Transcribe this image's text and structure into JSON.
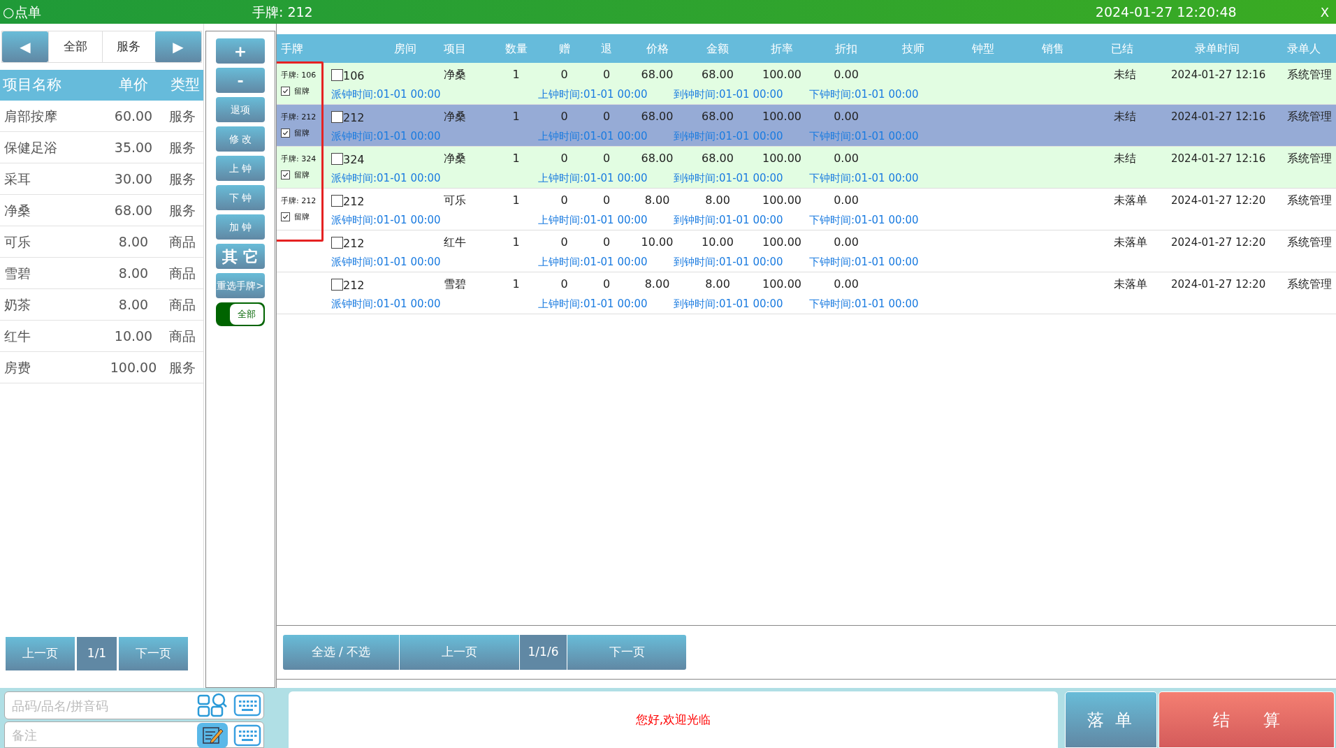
{
  "title_bar": {
    "title": "○点单",
    "tag": "手牌: 212",
    "datetime": "2024-01-27 12:20:48",
    "close": "X"
  },
  "category_nav": {
    "prev": "◀",
    "tabs": [
      {
        "label": "全部"
      },
      {
        "label": "服务"
      }
    ],
    "next": "▶"
  },
  "item_list": {
    "columns": [
      "项目名称",
      "单价",
      "类型"
    ],
    "rows": [
      [
        "肩部按摩",
        "60.00",
        "服务"
      ],
      [
        "保健足浴",
        "35.00",
        "服务"
      ],
      [
        "采耳",
        "30.00",
        "服务"
      ],
      [
        "净桑",
        "68.00",
        "服务"
      ],
      [
        "可乐",
        "8.00",
        "商品"
      ],
      [
        "雪碧",
        "8.00",
        "商品"
      ],
      [
        "奶茶",
        "8.00",
        "商品"
      ],
      [
        "红牛",
        "10.00",
        "商品"
      ],
      [
        "房费",
        "100.00",
        "服务"
      ]
    ],
    "pager": {
      "prev": "上一页",
      "page": "1/1",
      "next": "下一页"
    }
  },
  "actions": [
    {
      "label": "+",
      "kind": "large"
    },
    {
      "label": "-",
      "kind": "large"
    },
    {
      "label": "退项",
      "kind": "normal"
    },
    {
      "label": "修 改",
      "kind": "normal"
    },
    {
      "label": "上 钟",
      "kind": "normal"
    },
    {
      "label": "下 钟",
      "kind": "normal"
    },
    {
      "label": "加 钟",
      "kind": "normal"
    },
    {
      "label": "其 它",
      "kind": "large"
    },
    {
      "label": "重选手牌>",
      "kind": "normal"
    }
  ],
  "filter_toggle": {
    "label": "全部",
    "on": true
  },
  "orders": {
    "columns": [
      "手牌",
      "房间",
      "项目",
      "数量",
      "赠",
      "退",
      "价格",
      "金额",
      "折率",
      "折扣",
      "技师",
      "钟型",
      "销售",
      "已结",
      "录单时间",
      "录单人"
    ],
    "annotation_frame": true,
    "rows": [
      {
        "tag": "手牌: 106",
        "keep_label": "留牌",
        "keep": true,
        "checked": false,
        "room": "106",
        "item": "净桑",
        "qty": "1",
        "free": "0",
        "returned": "0",
        "price": "68.00",
        "amount": "68.00",
        "rate": "100.00",
        "discount": "0.00",
        "settled": "未结",
        "time": "2024-01-27 12:16",
        "user": "系统管理",
        "highlight": true,
        "selected": false,
        "times": [
          "派钟时间:01-01 00:00",
          "上钟时间:01-01 00:00",
          "到钟时间:01-01 00:00",
          "下钟时间:01-01 00:00"
        ]
      },
      {
        "tag": "手牌: 212",
        "keep_label": "留牌",
        "keep": true,
        "checked": false,
        "room": "212",
        "item": "净桑",
        "qty": "1",
        "free": "0",
        "returned": "0",
        "price": "68.00",
        "amount": "68.00",
        "rate": "100.00",
        "discount": "0.00",
        "settled": "未结",
        "time": "2024-01-27 12:16",
        "user": "系统管理",
        "selected": true,
        "times": [
          "派钟时间:01-01 00:00",
          "上钟时间:01-01 00:00",
          "到钟时间:01-01 00:00",
          "下钟时间:01-01 00:00"
        ]
      },
      {
        "tag": "手牌: 324",
        "keep_label": "留牌",
        "keep": true,
        "checked": false,
        "room": "324",
        "item": "净桑",
        "qty": "1",
        "free": "0",
        "returned": "0",
        "price": "68.00",
        "amount": "68.00",
        "rate": "100.00",
        "discount": "0.00",
        "settled": "未结",
        "time": "2024-01-27 12:16",
        "user": "系统管理",
        "highlight": true,
        "selected": false,
        "times": [
          "派钟时间:01-01 00:00",
          "上钟时间:01-01 00:00",
          "到钟时间:01-01 00:00",
          "下钟时间:01-01 00:00"
        ]
      },
      {
        "tag": "手牌: 212",
        "keep_label": "留牌",
        "keep": true,
        "checked": false,
        "room": "212",
        "item": "可乐",
        "qty": "1",
        "free": "0",
        "returned": "0",
        "price": "8.00",
        "amount": "8.00",
        "rate": "100.00",
        "discount": "0.00",
        "settled": "未落单",
        "time": "2024-01-27 12:20",
        "user": "系统管理",
        "highlight": false,
        "selected": false,
        "times": [
          "派钟时间:01-01 00:00",
          "上钟时间:01-01 00:00",
          "到钟时间:01-01 00:00",
          "下钟时间:01-01 00:00"
        ]
      },
      {
        "checked": false,
        "room": "212",
        "item": "红牛",
        "qty": "1",
        "free": "0",
        "returned": "0",
        "price": "10.00",
        "amount": "10.00",
        "rate": "100.00",
        "discount": "0.00",
        "settled": "未落单",
        "time": "2024-01-27 12:20",
        "user": "系统管理",
        "highlight": false,
        "selected": false,
        "times": [
          "派钟时间:01-01 00:00",
          "上钟时间:01-01 00:00",
          "到钟时间:01-01 00:00",
          "下钟时间:01-01 00:00"
        ]
      },
      {
        "checked": false,
        "room": "212",
        "item": "雪碧",
        "qty": "1",
        "free": "0",
        "returned": "0",
        "price": "8.00",
        "amount": "8.00",
        "rate": "100.00",
        "discount": "0.00",
        "settled": "未落单",
        "time": "2024-01-27 12:20",
        "user": "系统管理",
        "highlight": false,
        "selected": false,
        "times": [
          "派钟时间:01-01 00:00",
          "上钟时间:01-01 00:00",
          "到钟时间:01-01 00:00",
          "下钟时间:01-01 00:00"
        ]
      }
    ],
    "pager": {
      "select_all": "全选 / 不选",
      "prev": "上一页",
      "page": "1/1/6",
      "next": "下一页"
    }
  },
  "bottom": {
    "search": {
      "placeholder": "品码/品名/拼音码"
    },
    "remark": {
      "placeholder": "备注"
    },
    "message": "您好,欢迎光临",
    "submit": "落 单",
    "checkout": "结　　算"
  }
}
